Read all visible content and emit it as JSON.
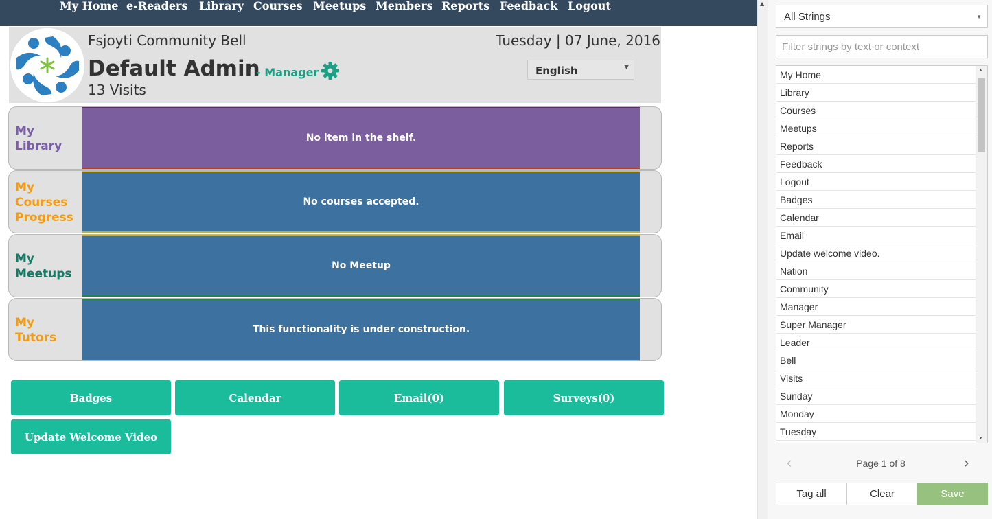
{
  "nav": {
    "items": [
      "My Home",
      "e-Readers",
      "Library",
      "Courses",
      "Meetups",
      "Members",
      "Reports",
      "Feedback",
      "Logout"
    ]
  },
  "header": {
    "community": "Fsjoyti Community Bell",
    "username": "Default Admin",
    "role": "- Manager",
    "visits": "13 Visits",
    "date": "Tuesday | 07 June, 2016",
    "language": "English"
  },
  "shelves": [
    {
      "label_lines": [
        "My",
        "Library"
      ],
      "message": "No item in the shelf.",
      "label_color": "#7b5ea7",
      "panel_color": "#7b5e9e",
      "top_border": "#5b2c6f",
      "bottom_border": "#c0392b"
    },
    {
      "label_lines": [
        "My",
        "Courses",
        "Progress"
      ],
      "message": "No courses accepted.",
      "label_color": "#f39c12",
      "panel_color": "#3d72a0",
      "top_border": "#e6b822",
      "bottom_border": "#c4b21a"
    },
    {
      "label_lines": [
        "My",
        "Meetups"
      ],
      "message": "No Meetup",
      "label_color": "#167a66",
      "panel_color": "#3d72a0",
      "top_border": "#d4ac0d",
      "bottom_border": "#1e8449"
    },
    {
      "label_lines": [
        "My",
        "Tutors"
      ],
      "message": "This functionality is under construction.",
      "label_color": "#f39c12",
      "panel_color": "#3d72a0",
      "top_border": "#1e8449",
      "bottom_border": "#3d72a0"
    }
  ],
  "actions": [
    "Badges",
    "Calendar",
    "Email(0)",
    "Surveys(0)",
    "Update Welcome Video"
  ],
  "strings_panel": {
    "filter_select": "All Strings",
    "search_placeholder": "Filter strings by text or context",
    "items": [
      "My Home",
      "Library",
      "Courses",
      "Meetups",
      "Reports",
      "Feedback",
      "Logout",
      "Badges",
      "Calendar",
      "Email",
      "Update welcome video.",
      "Nation",
      "Community",
      "Manager",
      "Super Manager",
      "Leader",
      "Bell",
      "Visits",
      "Sunday",
      "Monday",
      "Tuesday"
    ],
    "page_label": "Page 1 of 8",
    "tag_all": "Tag all",
    "clear": "Clear",
    "save": "Save"
  },
  "colors": {
    "nav_bg": "#34495e",
    "accent": "#1abc9c",
    "manager": "#1aa085",
    "save": "#96c17f"
  }
}
